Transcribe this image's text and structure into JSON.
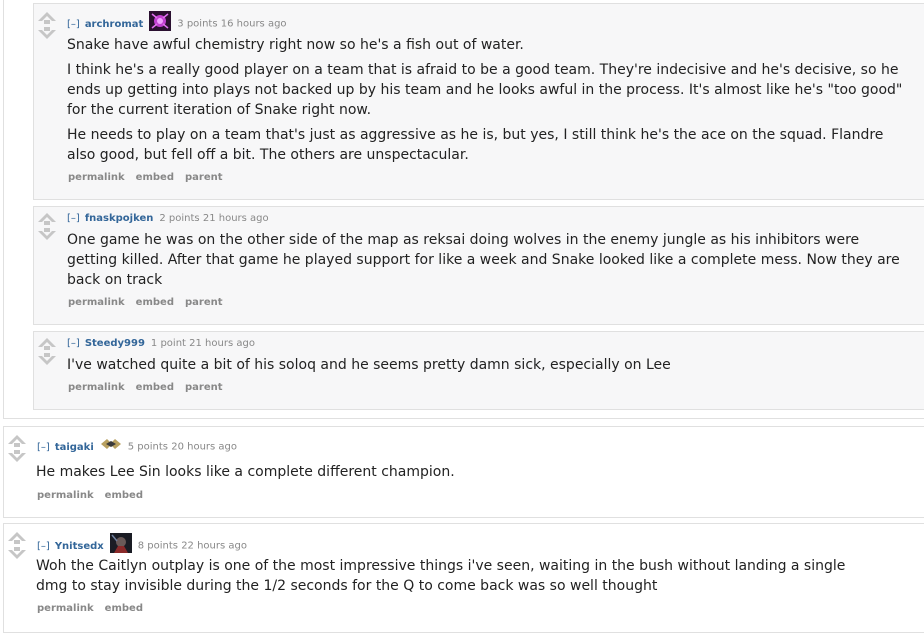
{
  "comments": [
    {
      "author": "archromat",
      "expand": "[–]",
      "points": "3 points",
      "time": "16 hours ago",
      "flair": "purple-champion-icon",
      "paragraphs": [
        "Snake have awful chemistry right now so he's a fish out of water.",
        "I think he's a really good player on a team that is afraid to be a good team. They're indecisive and he's decisive, so he ends up getting into plays not backed up by his team and he looks awful in the process. It's almost like he's \"too good\" for the current iteration of Snake right now.",
        "He needs to play on a team that's just as aggressive as he is, but yes, I still think he's the ace on the squad. Flandre also good, but fell off a bit. The others are unspectacular."
      ],
      "buttons": [
        "permalink",
        "embed",
        "parent"
      ]
    },
    {
      "author": "fnaskpojken",
      "expand": "[–]",
      "points": "2 points",
      "time": "21 hours ago",
      "paragraphs": [
        "One game he was on the other side of the map as reksai doing wolves in the enemy jungle as his inhibitors were getting killed. After that game he played support for like a week and Snake looked like a complete mess. Now they are back on track"
      ],
      "buttons": [
        "permalink",
        "embed",
        "parent"
      ]
    },
    {
      "author": "Steedy999",
      "expand": "[–]",
      "points": "1 point",
      "time": "21 hours ago",
      "paragraphs": [
        "I've watched quite a bit of his soloq and he seems pretty damn sick, especially on Lee"
      ],
      "buttons": [
        "permalink",
        "embed",
        "parent"
      ]
    },
    {
      "author": "taigaki",
      "expand": "[–]",
      "points": "5 points",
      "time": "20 hours ago",
      "flair": "team-logo-icon",
      "paragraphs": [
        "He makes Lee Sin looks like a complete different champion."
      ],
      "buttons": [
        "permalink",
        "embed"
      ]
    },
    {
      "author": "Ynitsedx",
      "expand": "[–]",
      "points": "8 points",
      "time": "22 hours ago",
      "flair": "dark-champion-icon",
      "paragraphs": [
        "Woh the Caitlyn outplay is one of the most impressive things i've seen, waiting in the bush without landing a single dmg to stay invisible during the 1/2 seconds for the Q to come back was so well thought"
      ],
      "buttons": [
        "permalink",
        "embed"
      ]
    }
  ],
  "colors": {
    "author": "#336699",
    "meta": "#888888",
    "border": "#e0e0e0",
    "nested_bg": "#f7f7f8"
  }
}
